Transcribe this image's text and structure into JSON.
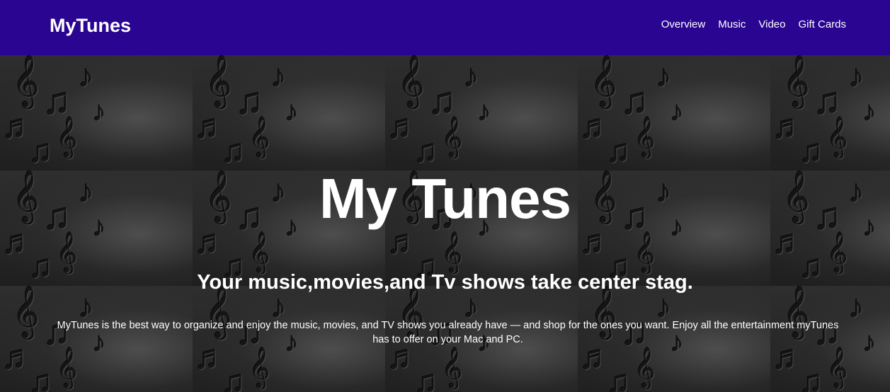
{
  "navbar": {
    "brand": "MyTunes",
    "links": [
      "Overview",
      "Music",
      "Video",
      "Gift Cards"
    ],
    "background_color": "#2a0592"
  },
  "hero": {
    "title": "My Tunes",
    "subtitle": "Your music,movies,and Tv shows take center stag.",
    "description": "MyTunes is the best way to organize and enjoy the music, movies, and TV shows you already have — and shop for the ones you want. Enjoy all the entertainment myTunes has to offer on your Mac and PC.",
    "background": "music-notes-pattern-icon"
  }
}
